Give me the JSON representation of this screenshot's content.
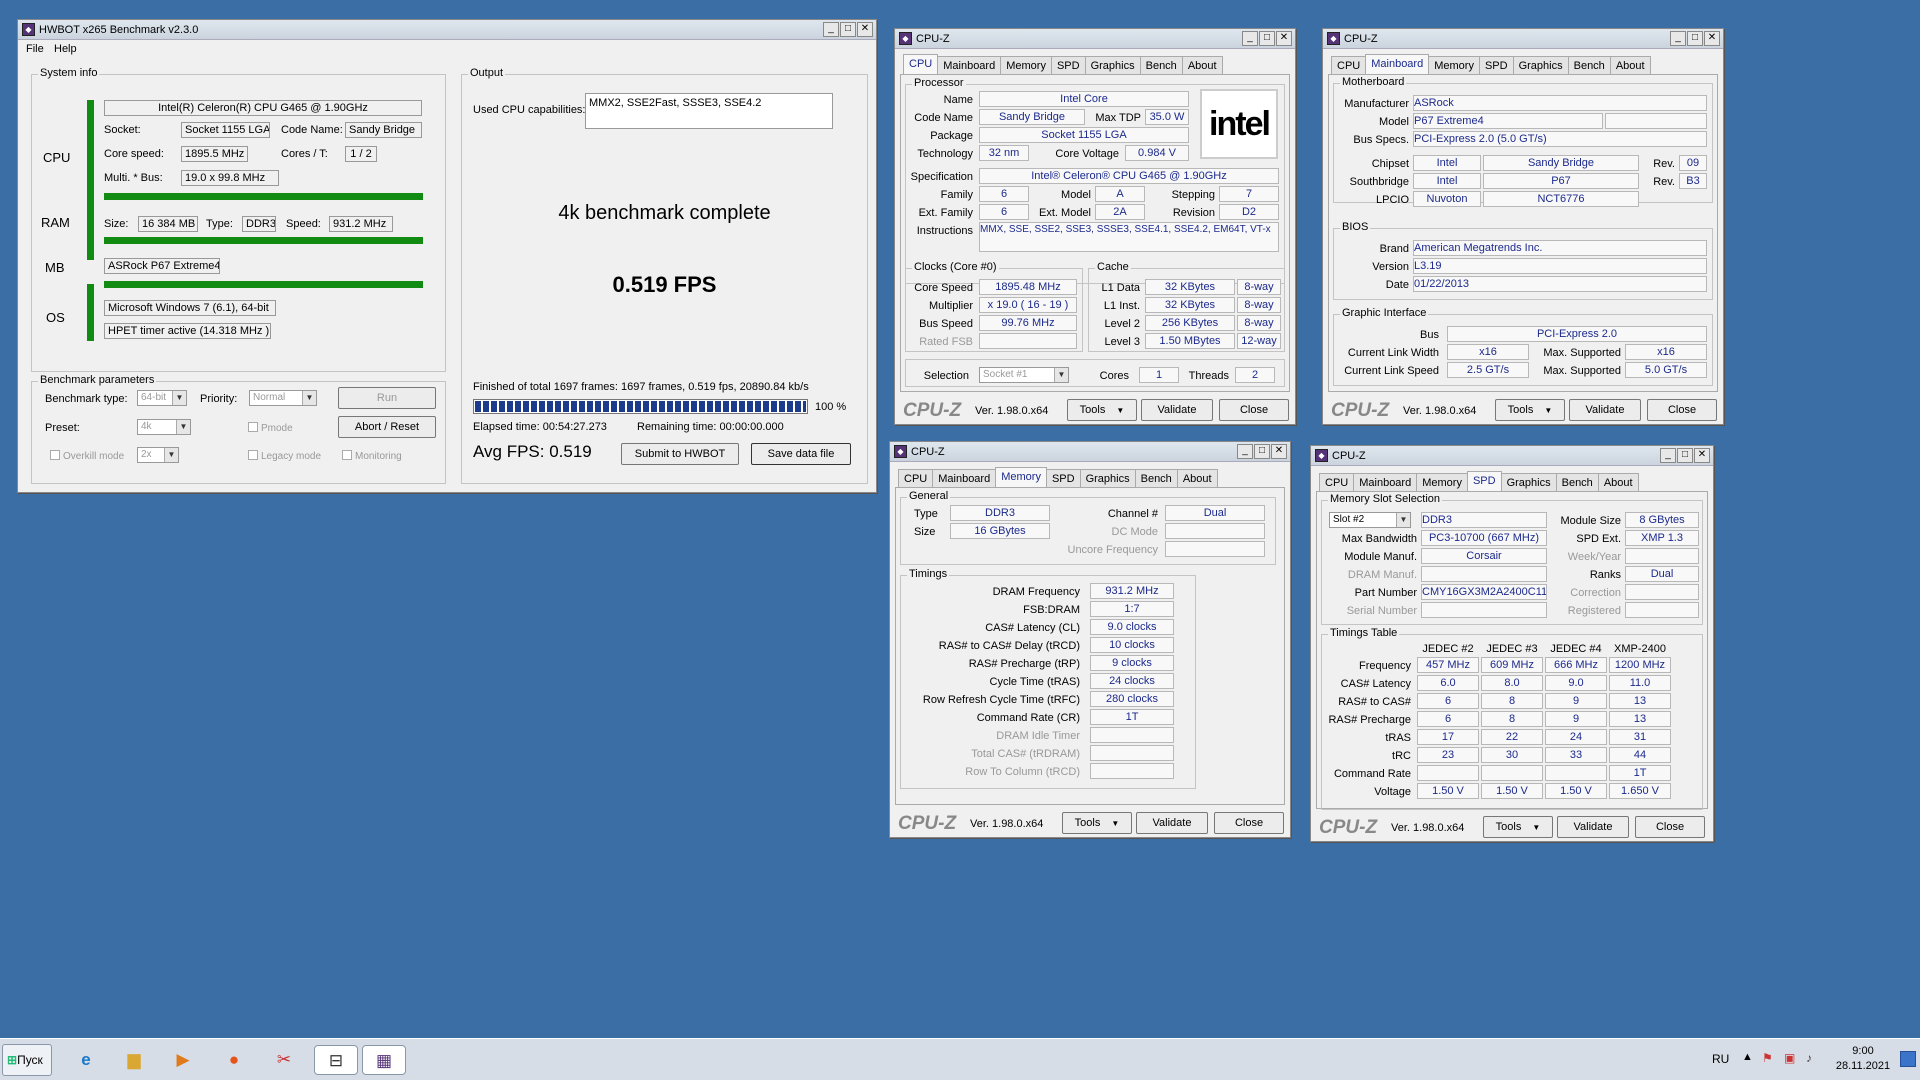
{
  "hwbot": {
    "title": "HWBOT x265 Benchmark v2.3.0",
    "menu": [
      "File",
      "Help"
    ],
    "sysinfo_title": "System info",
    "side_labels": [
      "CPU",
      "RAM",
      "MB",
      "OS"
    ],
    "cpu_name": "Intel(R) Celeron(R) CPU G465 @ 1.90GHz",
    "socket_label": "Socket:",
    "socket": "Socket 1155 LGA",
    "codename_label": "Code Name:",
    "codename": "Sandy Bridge",
    "corespeed_label": "Core speed:",
    "corespeed": "1895.5 MHz",
    "cores_label": "Cores / T:",
    "cores": "1 / 2",
    "multi_label": "Multi. * Bus:",
    "multi": "19.0 x 99.8 MHz",
    "size_label": "Size:",
    "size": "16 384 MB",
    "type_label": "Type:",
    "type": "DDR3",
    "speed_label": "Speed:",
    "speed": "931.2 MHz",
    "mb": "ASRock P67 Extreme4",
    "os": "Microsoft Windows 7 (6.1), 64-bit",
    "timer": "HPET timer active (14.318 MHz )",
    "params_title": "Benchmark parameters",
    "btype_label": "Benchmark type:",
    "btype": "64-bit",
    "priority_label": "Priority:",
    "priority": "Normal",
    "preset_label": "Preset:",
    "preset": "4k",
    "run": "Run",
    "abort": "Abort / Reset",
    "pmode": "Pmode",
    "overkill": "Overkill mode",
    "overkill_val": "2x",
    "legacy": "Legacy mode",
    "monitoring": "Monitoring",
    "output_title": "Output",
    "caps_label": "Used CPU capabilities:",
    "caps": "MMX2, SSE2Fast, SSSE3, SSE4.2",
    "complete": "4k benchmark complete",
    "fps": "0.519 FPS",
    "finished": "Finished of total 1697 frames: 1697 frames, 0.519 fps,  20890.84 kb/s",
    "progress_pct": "100 %",
    "progress": 1.0,
    "elapsed": "Elapsed time: 00:54:27.273",
    "remaining": "Remaining time: 00:00:00.000",
    "avgfps": "Avg FPS: 0.519",
    "submit": "Submit to HWBOT",
    "save": "Save data file"
  },
  "cpuz": {
    "title": "CPU-Z",
    "tabs": [
      "CPU",
      "Mainboard",
      "Memory",
      "SPD",
      "Graphics",
      "Bench",
      "About"
    ],
    "logo": "CPU-Z",
    "version": "Ver. 1.98.0.x64",
    "tools": "Tools",
    "validate": "Validate",
    "close": "Close"
  },
  "cpu": {
    "processor": "Processor",
    "name_l": "Name",
    "name": "Intel Core",
    "codename_l": "Code Name",
    "codename": "Sandy Bridge",
    "tdp_l": "Max TDP",
    "tdp": "35.0 W",
    "package_l": "Package",
    "package": "Socket 1155 LGA",
    "tech_l": "Technology",
    "tech": "32 nm",
    "voltage_l": "Core Voltage",
    "voltage": "0.984 V",
    "spec_l": "Specification",
    "spec": "Intel® Celeron® CPU G465 @ 1.90GHz",
    "family_l": "Family",
    "family": "6",
    "model_l": "Model",
    "model": "A",
    "stepping_l": "Stepping",
    "stepping": "7",
    "extfamily_l": "Ext. Family",
    "extfamily": "6",
    "extmodel_l": "Ext. Model",
    "extmodel": "2A",
    "revision_l": "Revision",
    "revision": "D2",
    "instr_l": "Instructions",
    "instr": "MMX, SSE, SSE2, SSE3, SSSE3, SSE4.1, SSE4.2, EM64T, VT-x",
    "logo": "intel",
    "clocks": "Clocks (Core #0)",
    "corespeed_l": "Core Speed",
    "corespeed": "1895.48 MHz",
    "multi_l": "Multiplier",
    "multi": "x 19.0 ( 16 - 19 )",
    "bus_l": "Bus Speed",
    "bus": "99.76 MHz",
    "fsb_l": "Rated FSB",
    "cache": "Cache",
    "l1d_l": "L1 Data",
    "l1d": "32 KBytes",
    "l1d_w": "8-way",
    "l1i_l": "L1 Inst.",
    "l1i": "32 KBytes",
    "l1i_w": "8-way",
    "l2_l": "Level 2",
    "l2": "256 KBytes",
    "l2_w": "8-way",
    "l3_l": "Level 3",
    "l3": "1.50 MBytes",
    "l3_w": "12-way",
    "sel_l": "Selection",
    "sel": "Socket #1",
    "cores_l": "Cores",
    "cores": "1",
    "threads_l": "Threads",
    "threads": "2"
  },
  "mainboard": {
    "motherboard": "Motherboard",
    "manuf_l": "Manufacturer",
    "manuf": "ASRock",
    "model_l": "Model",
    "model": "P67 Extreme4",
    "bus_l": "Bus Specs.",
    "bus": "PCI-Express 2.0 (5.0 GT/s)",
    "chipset_l": "Chipset",
    "chipset_v": "Intel",
    "chipset_m": "Sandy Bridge",
    "rev_l": "Rev.",
    "chipset_rev": "09",
    "south_l": "Southbridge",
    "south_v": "Intel",
    "south_m": "P67",
    "south_rev": "B3",
    "lpcio_l": "LPCIO",
    "lpcio_v": "Nuvoton",
    "lpcio_m": "NCT6776",
    "bios": "BIOS",
    "brand_l": "Brand",
    "brand": "American Megatrends Inc.",
    "ver_l": "Version",
    "ver": "L3.19",
    "date_l": "Date",
    "date": "01/22/2013",
    "gi": "Graphic Interface",
    "gbus_l": "Bus",
    "gbus": "PCI-Express 2.0",
    "clw_l": "Current Link Width",
    "clw": "x16",
    "maxs_l": "Max. Supported",
    "mlw": "x16",
    "cls_l": "Current Link Speed",
    "cls": "2.5 GT/s",
    "mls": "5.0 GT/s"
  },
  "memory": {
    "general": "General",
    "type_l": "Type",
    "type": "DDR3",
    "size_l": "Size",
    "size": "16 GBytes",
    "channel_l": "Channel #",
    "channel": "Dual",
    "dcmode_l": "DC Mode",
    "uncore_l": "Uncore Frequency",
    "timings": "Timings",
    "rows": [
      {
        "l": "DRAM Frequency",
        "v": "931.2 MHz"
      },
      {
        "l": "FSB:DRAM",
        "v": "1:7"
      },
      {
        "l": "CAS# Latency (CL)",
        "v": "9.0 clocks"
      },
      {
        "l": "RAS# to CAS# Delay (tRCD)",
        "v": "10 clocks"
      },
      {
        "l": "RAS# Precharge (tRP)",
        "v": "9 clocks"
      },
      {
        "l": "Cycle Time (tRAS)",
        "v": "24 clocks"
      },
      {
        "l": "Row Refresh Cycle Time (tRFC)",
        "v": "280 clocks"
      },
      {
        "l": "Command Rate (CR)",
        "v": "1T"
      },
      {
        "l": "DRAM Idle Timer",
        "v": ""
      },
      {
        "l": "Total CAS# (tRDRAM)",
        "v": ""
      },
      {
        "l": "Row To Column (tRCD)",
        "v": ""
      }
    ]
  },
  "spd": {
    "slotsel": "Memory Slot Selection",
    "slot": "Slot #2",
    "type": "DDR3",
    "modsize_l": "Module Size",
    "modsize": "8 GBytes",
    "maxbw_l": "Max Bandwidth",
    "maxbw": "PC3-10700 (667 MHz)",
    "spdext_l": "SPD Ext.",
    "spdext": "XMP 1.3",
    "modmanuf_l": "Module Manuf.",
    "modmanuf": "Corsair",
    "weekyear_l": "Week/Year",
    "drammanuf_l": "DRAM Manuf.",
    "ranks_l": "Ranks",
    "ranks": "Dual",
    "part_l": "Part Number",
    "part": "CMY16GX3M2A2400C11",
    "correction_l": "Correction",
    "serial_l": "Serial Number",
    "registered_l": "Registered",
    "ttable": "Timings Table",
    "cols": [
      "JEDEC #2",
      "JEDEC #3",
      "JEDEC #4",
      "XMP-2400"
    ],
    "rows": [
      {
        "l": "Frequency",
        "v": [
          "457 MHz",
          "609 MHz",
          "666 MHz",
          "1200 MHz"
        ]
      },
      {
        "l": "CAS# Latency",
        "v": [
          "6.0",
          "8.0",
          "9.0",
          "11.0"
        ]
      },
      {
        "l": "RAS# to CAS#",
        "v": [
          "6",
          "8",
          "9",
          "13"
        ]
      },
      {
        "l": "RAS# Precharge",
        "v": [
          "6",
          "8",
          "9",
          "13"
        ]
      },
      {
        "l": "tRAS",
        "v": [
          "17",
          "22",
          "24",
          "31"
        ]
      },
      {
        "l": "tRC",
        "v": [
          "23",
          "30",
          "33",
          "44"
        ]
      },
      {
        "l": "Command Rate",
        "v": [
          "",
          "",
          "",
          "1T"
        ]
      },
      {
        "l": "Voltage",
        "v": [
          "1.50 V",
          "1.50 V",
          "1.50 V",
          "1.650 V"
        ]
      }
    ]
  },
  "taskbar": {
    "start": "Пуск",
    "lang": "RU",
    "time": "9:00",
    "date": "28.11.2021"
  }
}
